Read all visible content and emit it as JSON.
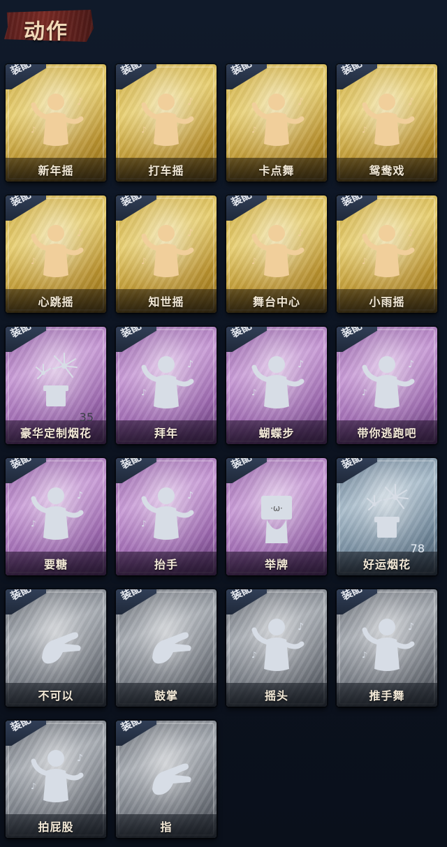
{
  "header": {
    "title": "动作"
  },
  "equip_label": "装配",
  "colors": {
    "gold": "#d9bb52",
    "purple": "#b07fc2",
    "blue": "#8da3b6",
    "gray": "#8b9097",
    "figure_gold": "#f1cf9b",
    "figure_silver": "#d7dde6"
  },
  "actions": [
    {
      "name": "新年摇",
      "rarity": "gold",
      "icon": "new-year-shake-figure-icon",
      "count": ""
    },
    {
      "name": "打车摇",
      "rarity": "gold",
      "icon": "taxi-shake-figure-icon",
      "count": ""
    },
    {
      "name": "卡点舞",
      "rarity": "gold",
      "icon": "beat-dance-figure-icon",
      "count": ""
    },
    {
      "name": "鸳鸯戏",
      "rarity": "gold",
      "icon": "mandarin-duck-figure-icon",
      "count": ""
    },
    {
      "name": "心跳摇",
      "rarity": "gold",
      "icon": "heartbeat-shake-figure-icon",
      "count": ""
    },
    {
      "name": "知世摇",
      "rarity": "gold",
      "icon": "zhishi-shake-figure-icon",
      "count": ""
    },
    {
      "name": "舞台中心",
      "rarity": "gold",
      "icon": "center-stage-figure-icon",
      "count": ""
    },
    {
      "name": "小雨摇",
      "rarity": "gold",
      "icon": "light-rain-shake-figure-icon",
      "count": ""
    },
    {
      "name": "豪华定制烟花",
      "rarity": "purple",
      "icon": "deluxe-fireworks-icon",
      "count": "35"
    },
    {
      "name": "拜年",
      "rarity": "purple",
      "icon": "new-year-greeting-figure-icon",
      "count": ""
    },
    {
      "name": "蝴蝶步",
      "rarity": "purple",
      "icon": "butterfly-step-figure-icon",
      "count": ""
    },
    {
      "name": "带你逃跑吧",
      "rarity": "purple",
      "icon": "run-away-figure-icon",
      "count": ""
    },
    {
      "name": "要糖",
      "rarity": "purple",
      "icon": "ask-candy-figure-icon",
      "count": ""
    },
    {
      "name": "抬手",
      "rarity": "purple",
      "icon": "raise-hand-figure-icon",
      "count": ""
    },
    {
      "name": "举牌",
      "rarity": "purple",
      "icon": "hold-sign-figure-icon",
      "count": ""
    },
    {
      "name": "好运烟花",
      "rarity": "blue",
      "icon": "lucky-fireworks-icon",
      "count": "78"
    },
    {
      "name": "不可以",
      "rarity": "gray",
      "icon": "finger-wag-icon",
      "count": ""
    },
    {
      "name": "鼓掌",
      "rarity": "gray",
      "icon": "clapping-hands-icon",
      "count": ""
    },
    {
      "name": "摇头",
      "rarity": "gray",
      "icon": "shake-head-figure-icon",
      "count": ""
    },
    {
      "name": "推手舞",
      "rarity": "gray",
      "icon": "push-hand-dance-figure-icon",
      "count": ""
    },
    {
      "name": "拍屁股",
      "rarity": "gray",
      "icon": "pat-butt-figure-icon",
      "count": ""
    },
    {
      "name": "指",
      "rarity": "gray",
      "icon": "pointing-hand-icon",
      "count": ""
    }
  ]
}
